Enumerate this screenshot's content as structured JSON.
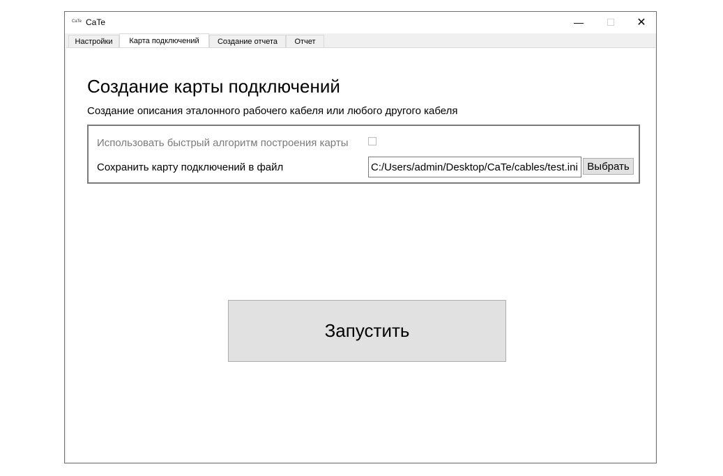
{
  "window": {
    "title": "CaTe",
    "app_icon_text": "CaTe",
    "controls": {
      "minimize": "—",
      "maximize": "☐",
      "close": "✕"
    }
  },
  "tabs": [
    {
      "label": "Настройки",
      "active": false
    },
    {
      "label": "Карта подключений",
      "active": true
    },
    {
      "label": "Создание отчета",
      "active": false
    },
    {
      "label": "Отчет",
      "active": false
    }
  ],
  "page": {
    "heading": "Создание карты подключений",
    "subtitle": "Создание описания эталонного рабочего кабеля или любого другого кабеля",
    "fast_algorithm": {
      "label": "Использовать быстрый алгоритм построения карты",
      "checked": false,
      "disabled": true
    },
    "save_to_file": {
      "label": "Сохранить карту подключений в файл",
      "path": "C:/Users/admin/Desktop/CaTe/cables/test.ini",
      "browse_label": "Выбрать"
    },
    "run_button_label": "Запустить"
  }
}
